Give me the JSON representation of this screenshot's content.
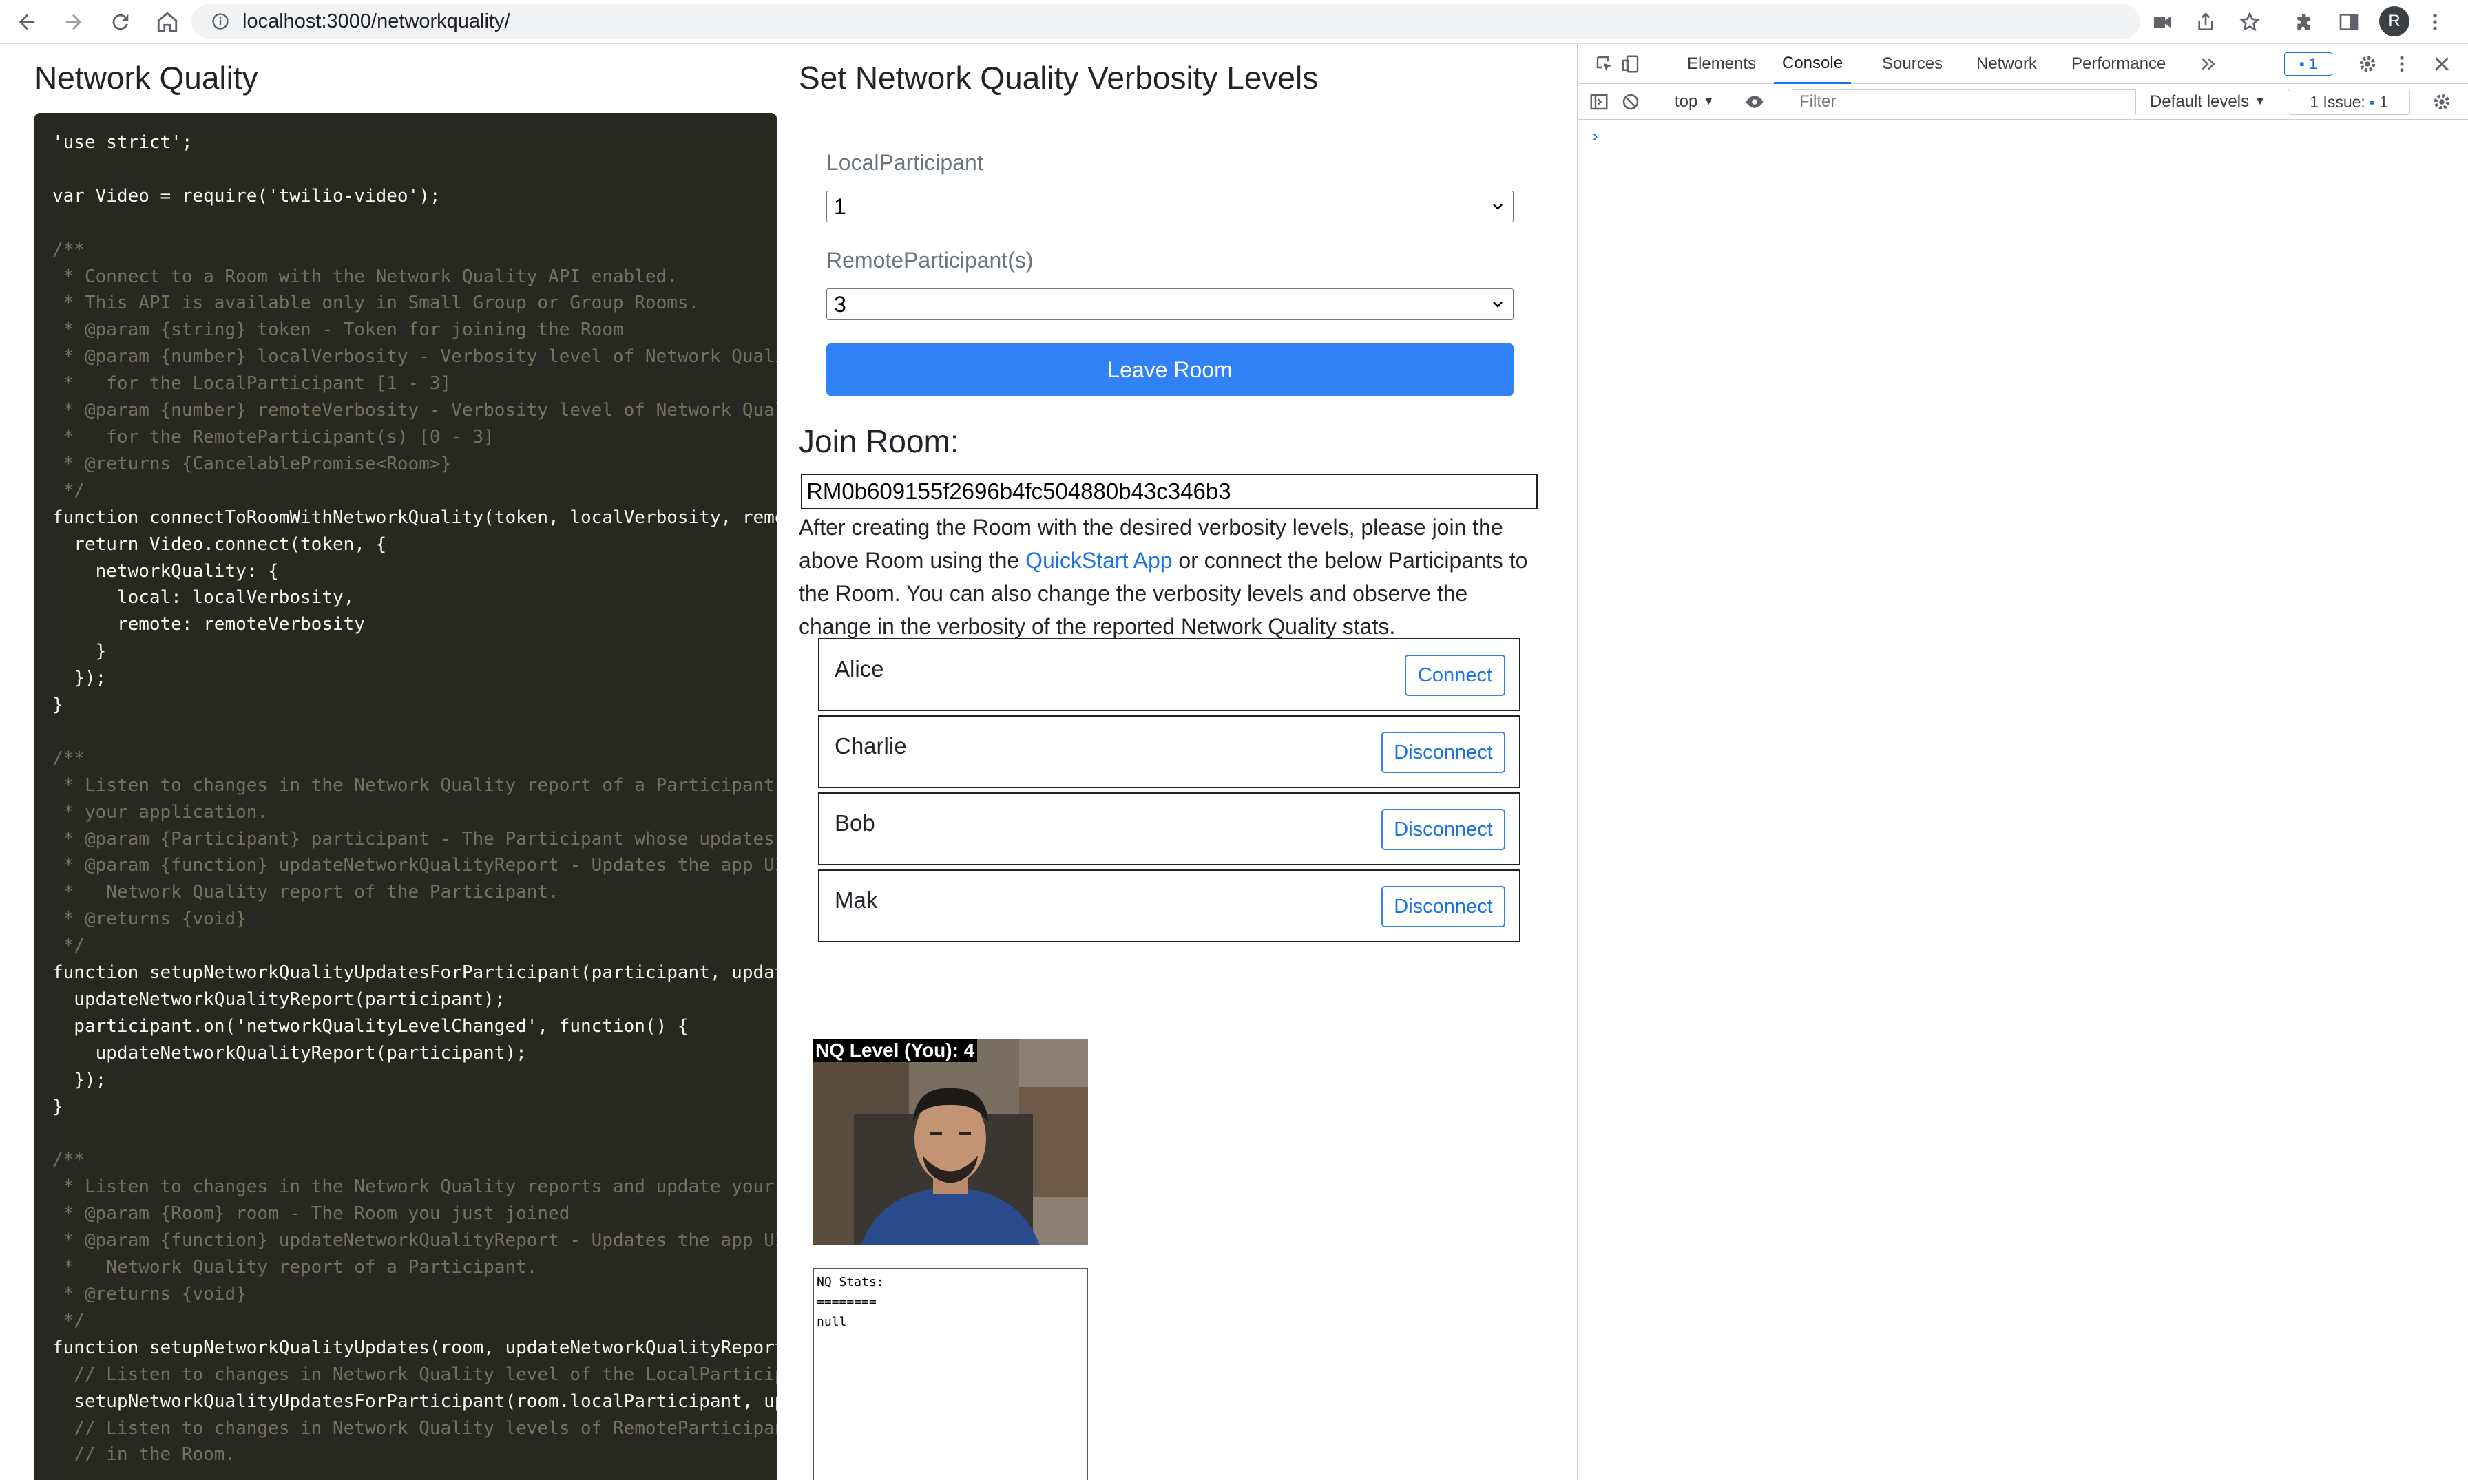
{
  "browser": {
    "url": "localhost:3000/networkquality/",
    "profile_initial": "R",
    "icons": [
      "back-icon",
      "forward-icon",
      "reload-icon",
      "home-icon",
      "info-icon",
      "camera-icon",
      "share-icon",
      "star-icon",
      "extensions-icon",
      "sidepanel-icon",
      "menu-icon"
    ]
  },
  "left": {
    "title": "Network Quality",
    "code_lines": [
      "'use strict';",
      "",
      "var Video = require('twilio-video');",
      "",
      "/**",
      " * Connect to a Room with the Network Quality API enabled.",
      " * This API is available only in Small Group or Group Rooms.",
      " * @param {string} token - Token for joining the Room",
      " * @param {number} localVerbosity - Verbosity level of Network Quali",
      " *   for the LocalParticipant [1 - 3]",
      " * @param {number} remoteVerbosity - Verbosity level of Network Qual",
      " *   for the RemoteParticipant(s) [0 - 3]",
      " * @returns {CancelablePromise<Room>}",
      " */",
      "function connectToRoomWithNetworkQuality(token, localVerbosity, remo",
      "  return Video.connect(token, {",
      "    networkQuality: {",
      "      local: localVerbosity,",
      "      remote: remoteVerbosity",
      "    }",
      "  });",
      "}",
      "",
      "/**",
      " * Listen to changes in the Network Quality report of a Participant",
      " * your application.",
      " * @param {Participant} participant - The Participant whose updates",
      " * @param {function} updateNetworkQualityReport - Updates the app UI",
      " *   Network Quality report of the Participant.",
      " * @returns {void}",
      " */",
      "function setupNetworkQualityUpdatesForParticipant(participant, updat",
      "  updateNetworkQualityReport(participant);",
      "  participant.on('networkQualityLevelChanged', function() {",
      "    updateNetworkQualityReport(participant);",
      "  });",
      "}",
      "",
      "/**",
      " * Listen to changes in the Network Quality reports and update your",
      " * @param {Room} room - The Room you just joined",
      " * @param {function} updateNetworkQualityReport - Updates the app UI",
      " *   Network Quality report of a Participant.",
      " * @returns {void}",
      " */",
      "function setupNetworkQualityUpdates(room, updateNetworkQualityReport",
      "  // Listen to changes in Network Quality level of the LocalParticip",
      "  setupNetworkQualityUpdatesForParticipant(room.localParticipant, up",
      "  // Listen to changes in Network Quality levels of RemoteParticipan",
      "  // in the Room."
    ]
  },
  "right": {
    "title": "Set Network Quality Verbosity Levels",
    "local_label": "LocalParticipant",
    "local_value": "1",
    "remote_label": "RemoteParticipant(s)",
    "remote_value": "3",
    "leave_button": "Leave Room",
    "join_title": "Join Room:",
    "room_sid": "RM0b609155f2696b4fc504880b43c346b3",
    "desc_1": "After creating the Room with the desired verbosity levels, please join the above Room using the ",
    "desc_link": "QuickStart App",
    "desc_2": " or connect the below Participants to the Room. You can also change the verbosity levels and observe the change in the verbosity of the reported Network Quality stats.",
    "participants": [
      {
        "name": "Alice",
        "action": "Connect"
      },
      {
        "name": "Charlie",
        "action": "Disconnect"
      },
      {
        "name": "Bob",
        "action": "Disconnect"
      },
      {
        "name": "Mak",
        "action": "Disconnect"
      }
    ],
    "nq_level": "NQ Level (You): 4",
    "nq_stats": "NQ Stats:\n========\nnull"
  },
  "devtools": {
    "tabs": [
      "Elements",
      "Console",
      "Sources",
      "Network",
      "Performance"
    ],
    "active_tab": "Console",
    "message_badge": "1",
    "context": "top",
    "filter_placeholder": "Filter",
    "levels": "Default levels",
    "issues": "1 Issue:",
    "issues_count": "1",
    "prompt": "›"
  }
}
